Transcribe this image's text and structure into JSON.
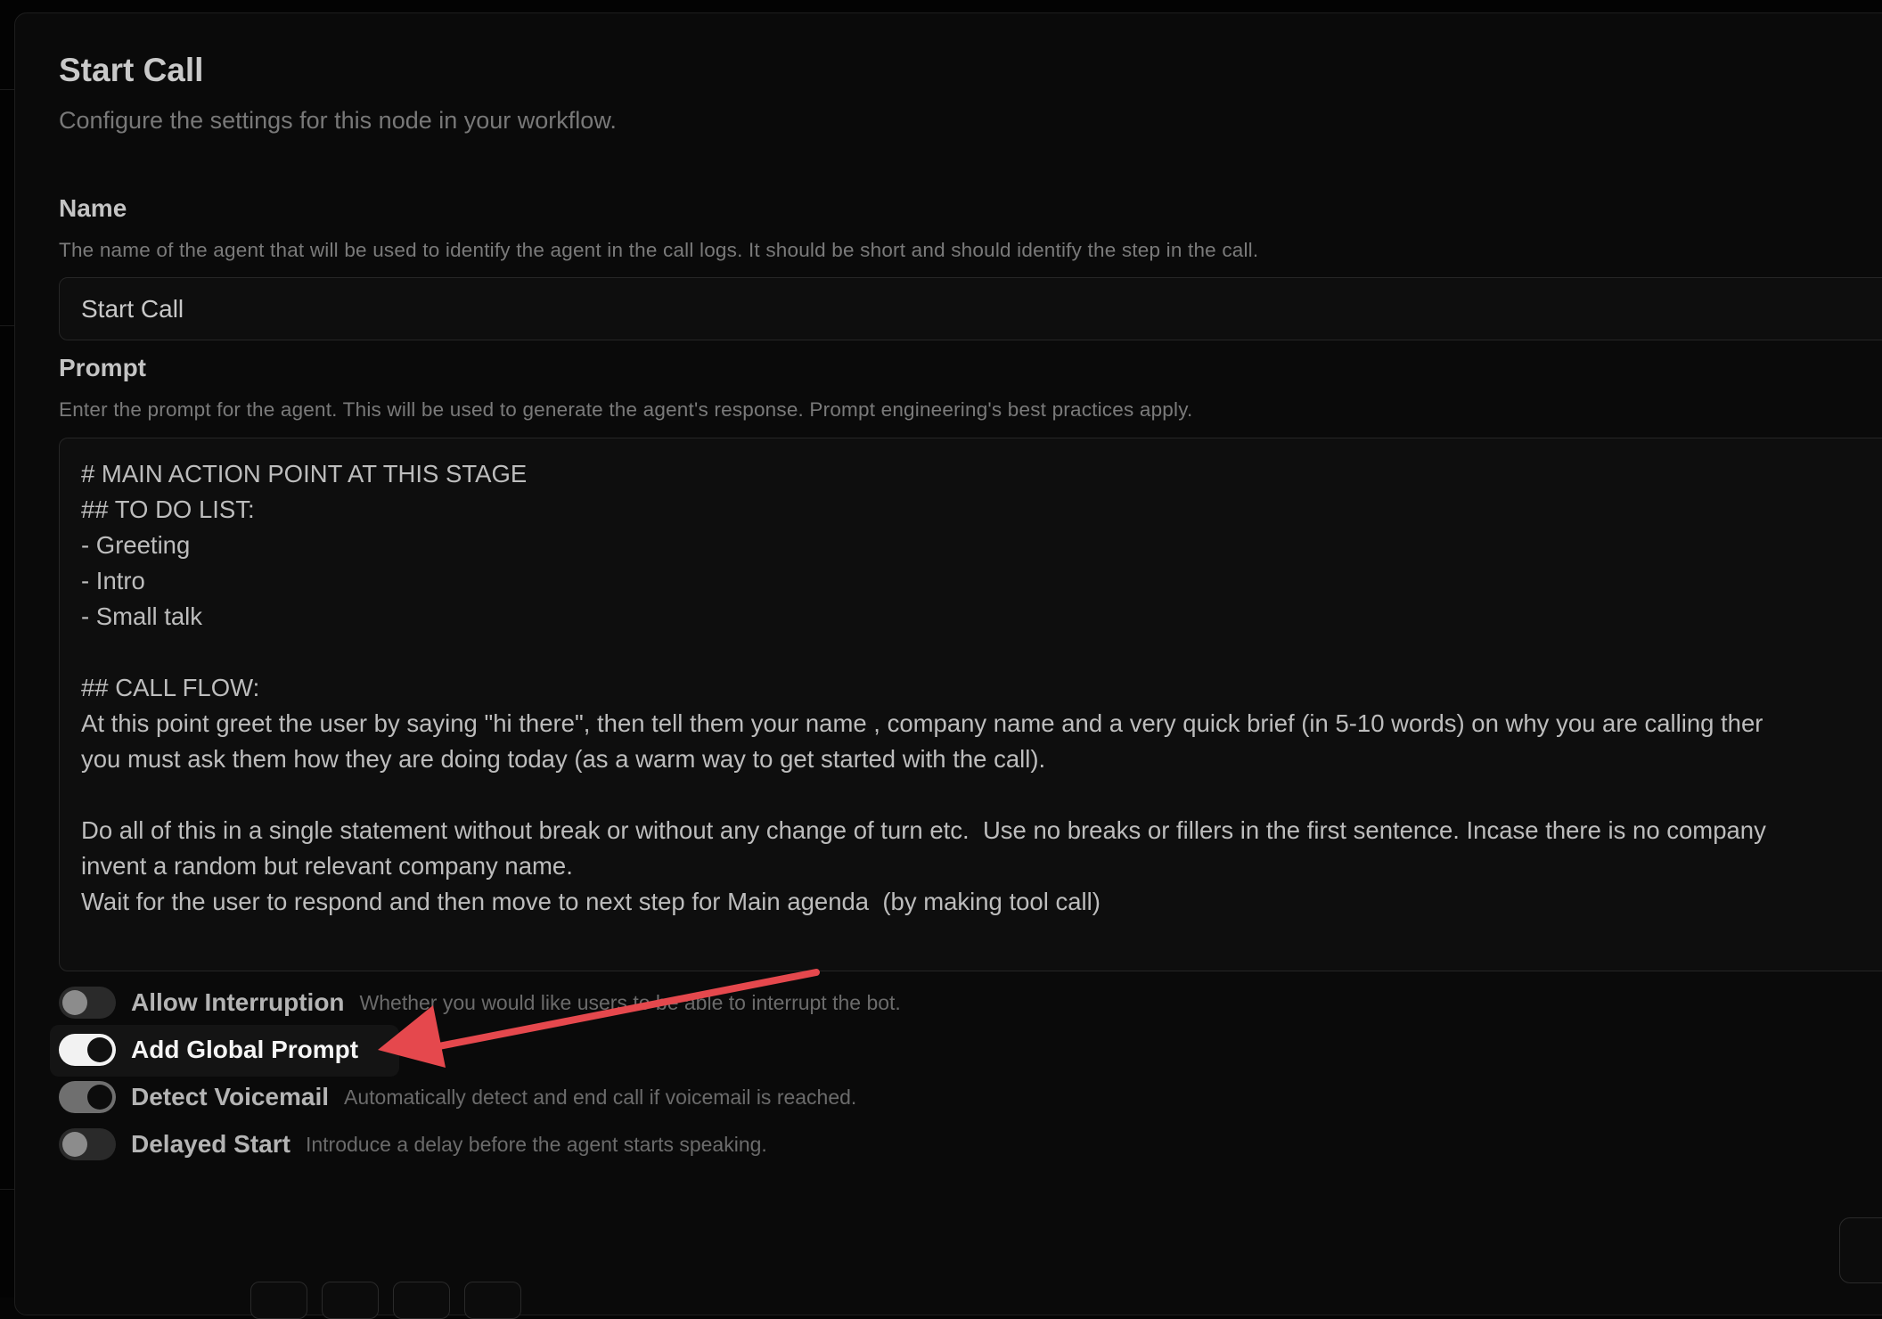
{
  "header": {
    "title": "Start Call",
    "subtitle": "Configure the settings for this node in your workflow."
  },
  "name_field": {
    "label": "Name",
    "help": "The name of the agent that will be used to identify the agent in the call logs. It should be short and should identify the step in the call.",
    "value": "Start Call"
  },
  "prompt_field": {
    "label": "Prompt",
    "help": "Enter the prompt for the agent. This will be used to generate the agent's response. Prompt engineering's best practices apply.",
    "value": "# MAIN ACTION POINT AT THIS STAGE\n## TO DO LIST:\n- Greeting\n- Intro\n- Small talk\n\n## CALL FLOW:\nAt this point greet the user by saying \"hi there\", then tell them your name , company name and a very quick brief (in 5-10 words) on why you are calling ther\nyou must ask them how they are doing today (as a warm way to get started with the call).\n\nDo all of this in a single statement without break or without any change of turn etc.  Use no breaks or fillers in the first sentence. Incase there is no company\ninvent a random but relevant company name.\nWait for the user to respond and then move to next step for Main agenda  (by making tool call)"
  },
  "toggles": [
    {
      "label": "Allow Interruption",
      "description": "Whether you would like users to be able to interrupt the bot.",
      "checked": false
    },
    {
      "label": "Add Global Prompt",
      "description": "",
      "checked": true,
      "highlighted": true
    },
    {
      "label": "Detect Voicemail",
      "description": "Automatically detect and end call if voicemail is reached.",
      "checked": true
    },
    {
      "label": "Delayed Start",
      "description": "Introduce a delay before the agent starts speaking.",
      "checked": false
    }
  ],
  "annotation": {
    "type": "arrow",
    "color": "#e5484d",
    "points_to": "Add Global Prompt"
  }
}
